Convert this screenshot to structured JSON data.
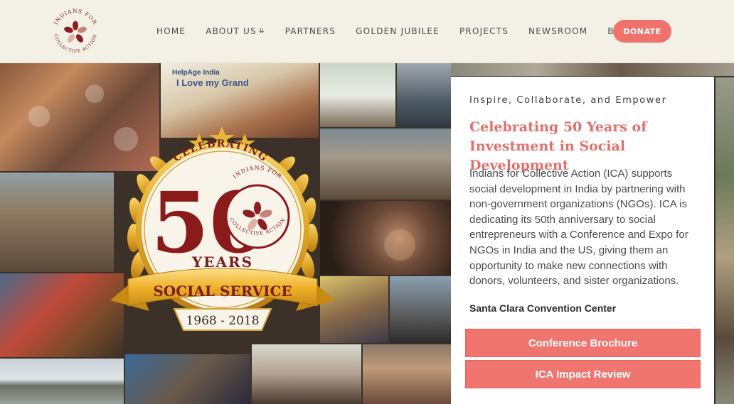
{
  "header": {
    "logo": {
      "arc_top": "INDIANS FOR",
      "arc_bottom": "COLLECTIVE ACTION",
      "icon": "hands-circle-logo"
    },
    "nav": [
      {
        "label": "HOME"
      },
      {
        "label": "ABOUT US",
        "icon": "chevron-down-double-icon"
      },
      {
        "label": "PARTNERS"
      },
      {
        "label": "GOLDEN JUBILEE"
      },
      {
        "label": "PROJECTS"
      },
      {
        "label": "NEWSROOM"
      },
      {
        "label": "BLOG"
      }
    ],
    "donate_label": "DONATE",
    "accent_color": "#f0726c"
  },
  "hero": {
    "photo_captions": {
      "banner_line_1": "HelpAge India",
      "banner_line_2": "I Love my Grand"
    },
    "emblem": {
      "celebrating": "CELEBRATING",
      "number": "50",
      "years": "YEARS",
      "seal_top": "INDIANS FOR",
      "seal_bottom": "COLLECTIVE ACTION",
      "ribbon": "SOCIAL SERVICE",
      "date_range": "1968 - 2018"
    }
  },
  "card": {
    "tagline": "Inspire, Collaborate, and Empower",
    "headline": "Celebrating 50 Years of Investment in Social Development",
    "description": "Indians for Collective Action (ICA) supports social development in India by partnering with non-government organizations (NGOs). ICA is dedicating its 50th anniversary to social entrepreneurs with a Conference and Expo for NGOs in India and the US, giving them an opportunity to make new connections with donors, volunteers, and sister organizations.",
    "venue": "Santa Clara Convention Center",
    "buttons": [
      {
        "label": "Conference Brochure"
      },
      {
        "label": "ICA Impact Review"
      }
    ],
    "button_color": "#f0756e",
    "headline_color": "#e0716a"
  }
}
